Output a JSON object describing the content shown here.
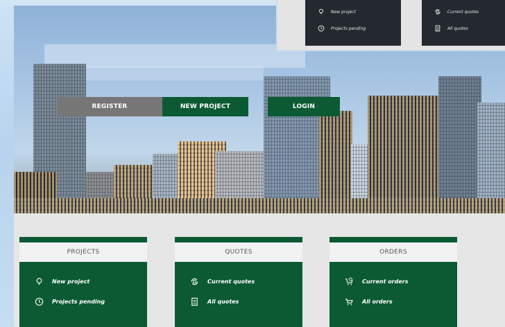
{
  "hero": {
    "register_label": "REGISTER",
    "new_project_label": "NEW PROJECT",
    "login_label": "LOGIN"
  },
  "overlay": {
    "card1": {
      "item1": "New project",
      "item2": "Projects pending"
    },
    "card2": {
      "item1": "Current quotes",
      "item2": "All quotes"
    }
  },
  "cards": {
    "projects": {
      "title": "PROJECTS",
      "item1": "New project",
      "item2": "Projects pending"
    },
    "quotes": {
      "title": "QUOTES",
      "item1": "Current quotes",
      "item2": "All quotes"
    },
    "orders": {
      "title": "ORDERS",
      "item1": "Current orders",
      "item2": "All orders"
    }
  },
  "colors": {
    "brand_green": "#0b5a33",
    "register_gray": "#767676",
    "panel_dark": "#24282f"
  },
  "icons": [
    "lightbulb-icon",
    "clock-icon",
    "quote-refresh-icon",
    "document-icon",
    "cart-clock-icon",
    "cart-icon"
  ]
}
